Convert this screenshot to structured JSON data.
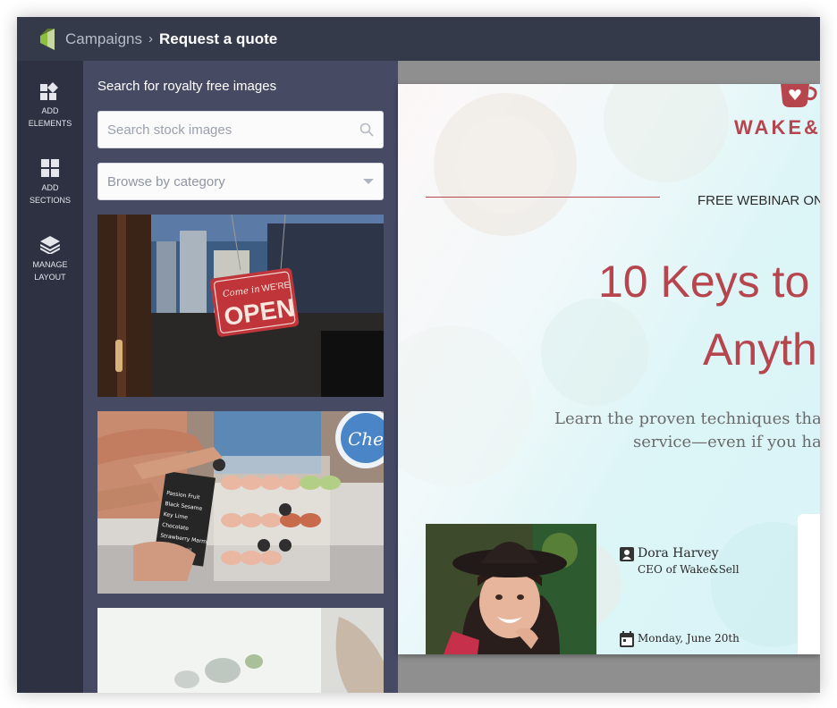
{
  "breadcrumb": {
    "parent": "Campaigns",
    "separator": "›",
    "current": "Request a quote"
  },
  "rail": {
    "items": [
      {
        "label": "ADD\nELEMENTS",
        "icon": "add-elements-icon"
      },
      {
        "label": "ADD\nSECTIONS",
        "icon": "add-sections-icon"
      },
      {
        "label": "MANAGE\nLAYOUT",
        "icon": "layers-icon"
      }
    ]
  },
  "panel": {
    "title": "Search for royalty free images",
    "search_placeholder": "Search stock images",
    "category_placeholder": "Browse by category",
    "images": [
      {
        "name": "open-sign-photo",
        "sign_script": "Come in",
        "sign_top": "WE'RE",
        "sign_main": "OPEN"
      },
      {
        "name": "macarons-stand-photo",
        "board_text": "Passion Fruit\nBlack Sesame\nKey Lime\nChocolate\nStrawberry Marmalade\nLemon Basil",
        "badge_text": "Che"
      },
      {
        "name": "cafe-table-photo"
      }
    ]
  },
  "landing": {
    "brand": "WAKE&SELL",
    "eyebrow": "FREE WEBINAR ON",
    "headline_line1": "10 Keys to",
    "headline_line2": "Anyth",
    "lead_line1": "Learn the proven techniques that wi",
    "lead_line2": "service—even if you have",
    "speaker_name": "Dora Harvey",
    "speaker_title": "CEO of Wake&Sell",
    "date": "Monday, June 20th"
  },
  "colors": {
    "topbar": "#353a4a",
    "rail": "#2d3142",
    "panel": "#464b63",
    "accent": "#b7454e"
  }
}
